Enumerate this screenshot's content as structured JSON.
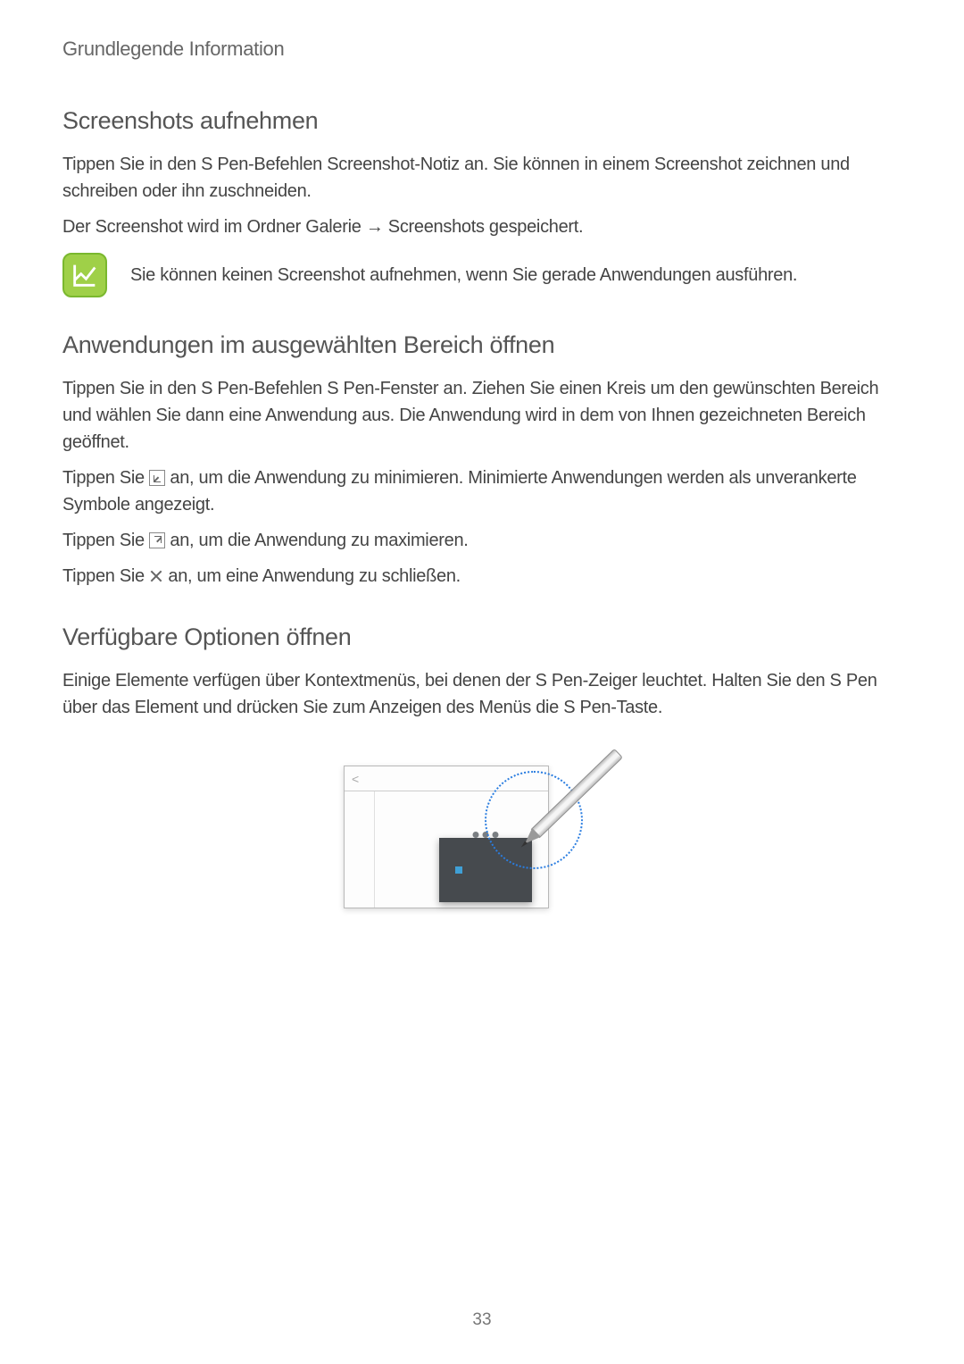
{
  "page": {
    "header": "Grundlegende Information",
    "number": "33"
  },
  "sections": {
    "screenshot": {
      "title": "Screenshots aufnehmen",
      "p1a": "Tippen Sie in den S Pen-Befehlen ",
      "p1b": "Screenshot-Notiz",
      "p1c": " an. Sie können in einem Screenshot zeichnen und schreiben oder ihn zuschneiden.",
      "p2a": "Der Screenshot wird im Ordner ",
      "p2b": "Galerie",
      "p2c": " → ",
      "p2d": "Screenshots",
      "p2e": " gespeichert.",
      "note": "Sie können keinen Screenshot aufnehmen, wenn Sie gerade Anwendungen ausführen."
    },
    "apps": {
      "title": "Anwendungen im ausgewählten Bereich öffnen",
      "p1a": "Tippen Sie in den S Pen-Befehlen ",
      "p1b": "S Pen-Fenster",
      "p1c": " an. Ziehen Sie einen Kreis um den gewünschten Bereich und wählen Sie dann eine Anwendung aus. Die Anwendung wird in dem von Ihnen gezeichneten Bereich geöffnet.",
      "p2a": "Tippen Sie ",
      "p2b": " an, um die Anwendung zu minimieren. Minimierte Anwendungen werden als unverankerte Symbole angezeigt.",
      "p3a": "Tippen Sie ",
      "p3b": " an, um die Anwendung zu maximieren.",
      "p4a": "Tippen Sie ",
      "p4b": " an, um eine Anwendung zu schließen."
    },
    "options": {
      "title": "Verfügbare Optionen öffnen",
      "p1": "Einige Elemente verfügen über Kontextmenüs, bei denen der S Pen-Zeiger leuchtet. Halten Sie den S Pen über das Element und drücken Sie zum Anzeigen des Menüs die S Pen-Taste."
    }
  }
}
